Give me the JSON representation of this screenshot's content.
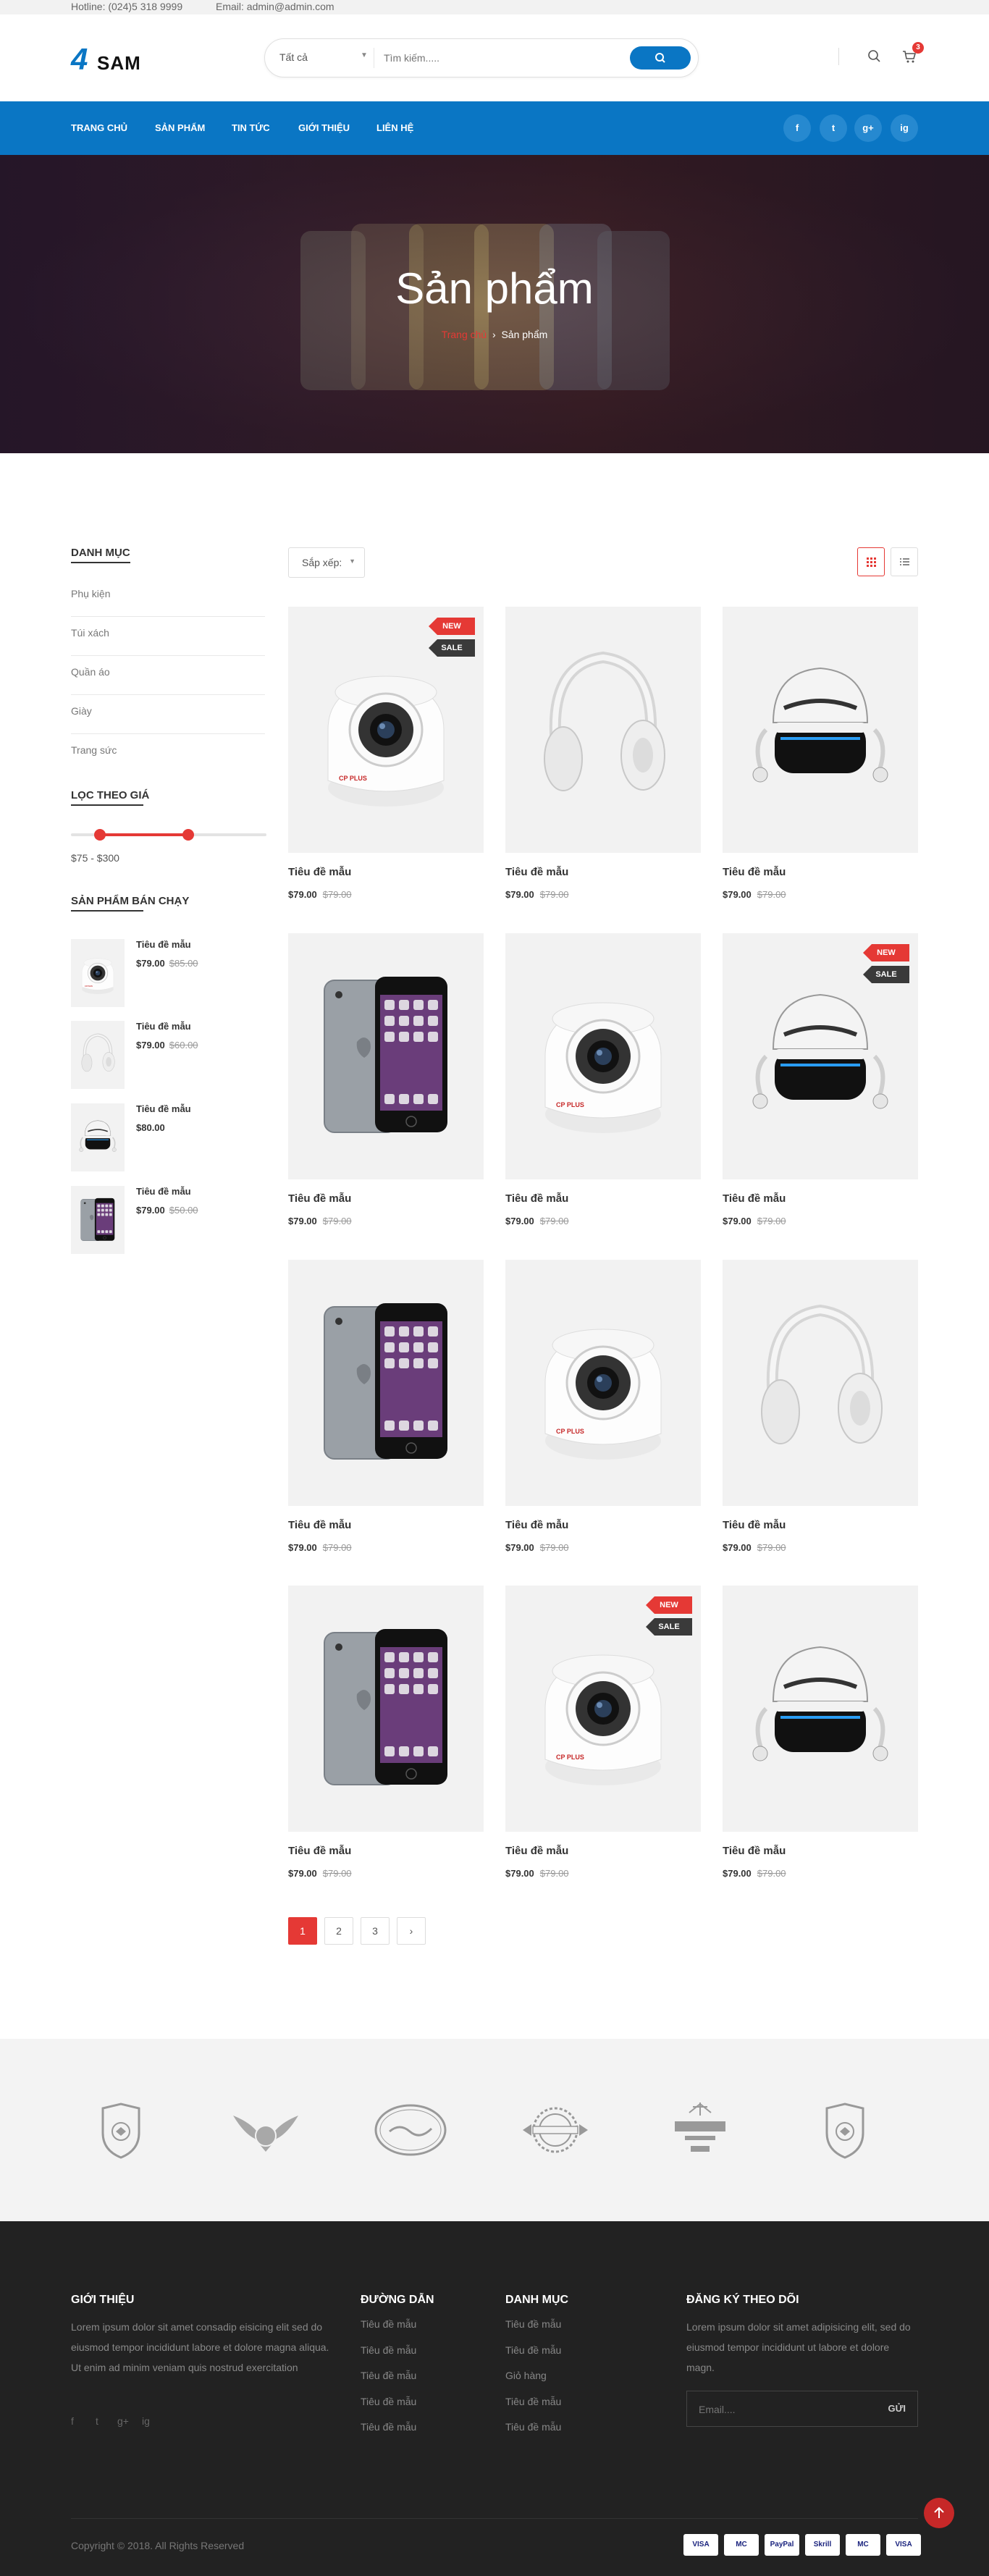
{
  "topbar": {
    "hotline": "Hotline: (024)5 318 9999",
    "email": "Email: admin@admin.com"
  },
  "header": {
    "logo_mark": "4",
    "logo_text": "SAM",
    "search_category": "Tất cả",
    "search_placeholder": "Tìm kiếm.....",
    "cart_count": "3"
  },
  "nav": {
    "items": [
      "TRANG CHỦ",
      "SẢN PHẨM",
      "TIN TỨC",
      "GIỚI THIỆU",
      "LIÊN HỆ"
    ],
    "social": [
      "f",
      "t",
      "g+",
      "ig"
    ]
  },
  "hero": {
    "title": "Sản phẩm",
    "crumb_home": "Trang chủ",
    "crumb_current": "Sản phẩm"
  },
  "sidebar": {
    "category_title": "DANH MỤC",
    "categories": [
      "Phụ kiện",
      "Túi xách",
      "Quần áo",
      "Giày",
      "Trang sức"
    ],
    "price_title": "LỌC THEO GIÁ",
    "price_range": "$75 - $300",
    "price_min": 75,
    "price_max": 300,
    "bestseller_title": "SẢN PHẨM BÁN CHẠY",
    "bestsellers": [
      {
        "title": "Tiêu đề mẫu",
        "price": "$79.00",
        "old": "$85.00",
        "img": "camera"
      },
      {
        "title": "Tiêu đề mẫu",
        "price": "$79.00",
        "old": "$60.00",
        "img": "headphone"
      },
      {
        "title": "Tiêu đề mẫu",
        "price": "$80.00",
        "old": "",
        "img": "vr"
      },
      {
        "title": "Tiêu đề mẫu",
        "price": "$79.00",
        "old": "$50.00",
        "img": "phone"
      }
    ]
  },
  "toolbar": {
    "sort_label": "Sắp xếp:"
  },
  "products": [
    {
      "title": "Tiêu đề mẫu",
      "price": "$79.00",
      "old": "$79.00",
      "img": "camera",
      "new": "NEW",
      "sale": "SALE"
    },
    {
      "title": "Tiêu đề mẫu",
      "price": "$79.00",
      "old": "$79.00",
      "img": "headphone"
    },
    {
      "title": "Tiêu đề mẫu",
      "price": "$79.00",
      "old": "$79.00",
      "img": "vr"
    },
    {
      "title": "Tiêu đề mẫu",
      "price": "$79.00",
      "old": "$79.00",
      "img": "phone"
    },
    {
      "title": "Tiêu đề mẫu",
      "price": "$79.00",
      "old": "$79.00",
      "img": "camera"
    },
    {
      "title": "Tiêu đề mẫu",
      "price": "$79.00",
      "old": "$79.00",
      "img": "vr",
      "new": "NEW",
      "sale": "SALE"
    },
    {
      "title": "Tiêu đề mẫu",
      "price": "$79.00",
      "old": "$79.00",
      "img": "phone"
    },
    {
      "title": "Tiêu đề mẫu",
      "price": "$79.00",
      "old": "$79.00",
      "img": "camera"
    },
    {
      "title": "Tiêu đề mẫu",
      "price": "$79.00",
      "old": "$79.00",
      "img": "headphone"
    },
    {
      "title": "Tiêu đề mẫu",
      "price": "$79.00",
      "old": "$79.00",
      "img": "phone"
    },
    {
      "title": "Tiêu đề mẫu",
      "price": "$79.00",
      "old": "$79.00",
      "img": "camera",
      "new": "NEW",
      "sale": "SALE"
    },
    {
      "title": "Tiêu đề mẫu",
      "price": "$79.00",
      "old": "$79.00",
      "img": "vr"
    }
  ],
  "pagination": [
    "1",
    "2",
    "3",
    "›"
  ],
  "brands": [
    "shield-badge",
    "eagle-badge",
    "mcqueen",
    "bavaria",
    "jefferson",
    "shield-badge"
  ],
  "footer": {
    "about_title": "GIỚI THIỆU",
    "about_text": "Lorem ipsum dolor sit amet consadip eisicing elit sed do eiusmod tempor incididunt labore et dolore magna aliqua. Ut enim ad minim veniam quis nostrud exercitation",
    "links_title": "ĐƯỜNG DẪN",
    "links": [
      "Tiêu đề mẫu",
      "Tiêu đề mẫu",
      "Tiêu đề mẫu",
      "Tiêu đề mẫu",
      "Tiêu đề mẫu"
    ],
    "cat_title": "DANH MỤC",
    "cats": [
      "Tiêu đề mẫu",
      "Tiêu đề mẫu",
      "Giỏ hàng",
      "Tiêu đề mẫu",
      "Tiêu đề mẫu"
    ],
    "sub_title": "ĐĂNG KÝ THEO DÕI",
    "sub_text": "Lorem ipsum dolor sit amet adipisicing elit, sed do eiusmod tempor incididunt ut labore et dolore magn.",
    "email_placeholder": "Email....",
    "sub_button": "GỬI",
    "social": [
      "f",
      "t",
      "g+",
      "ig"
    ],
    "copyright": "Copyright © 2018. All Rights Reserved",
    "payments": [
      "VISA",
      "MC",
      "PayPal",
      "Skrill",
      "MC",
      "VISA"
    ]
  }
}
